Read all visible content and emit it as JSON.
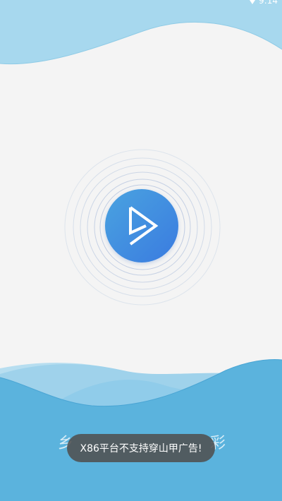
{
  "status_bar": {
    "time": "9:14"
  },
  "splash": {
    "slogan_left": "乡",
    "slogan_right": "彩"
  },
  "toast": {
    "message": "X86平台不支持穿山甲广告!"
  },
  "colors": {
    "background": "#f4f4f4",
    "wave_light": "#a7d8ee",
    "wave_mid": "#7cc4e6",
    "wave_dark": "#5bb3dd",
    "logo_gradient_start": "#4aa3e0",
    "logo_gradient_end": "#3a7be0",
    "toast_bg": "#505050"
  },
  "icons": {
    "status": "location-icon",
    "logo": "play-triangle-icon"
  }
}
